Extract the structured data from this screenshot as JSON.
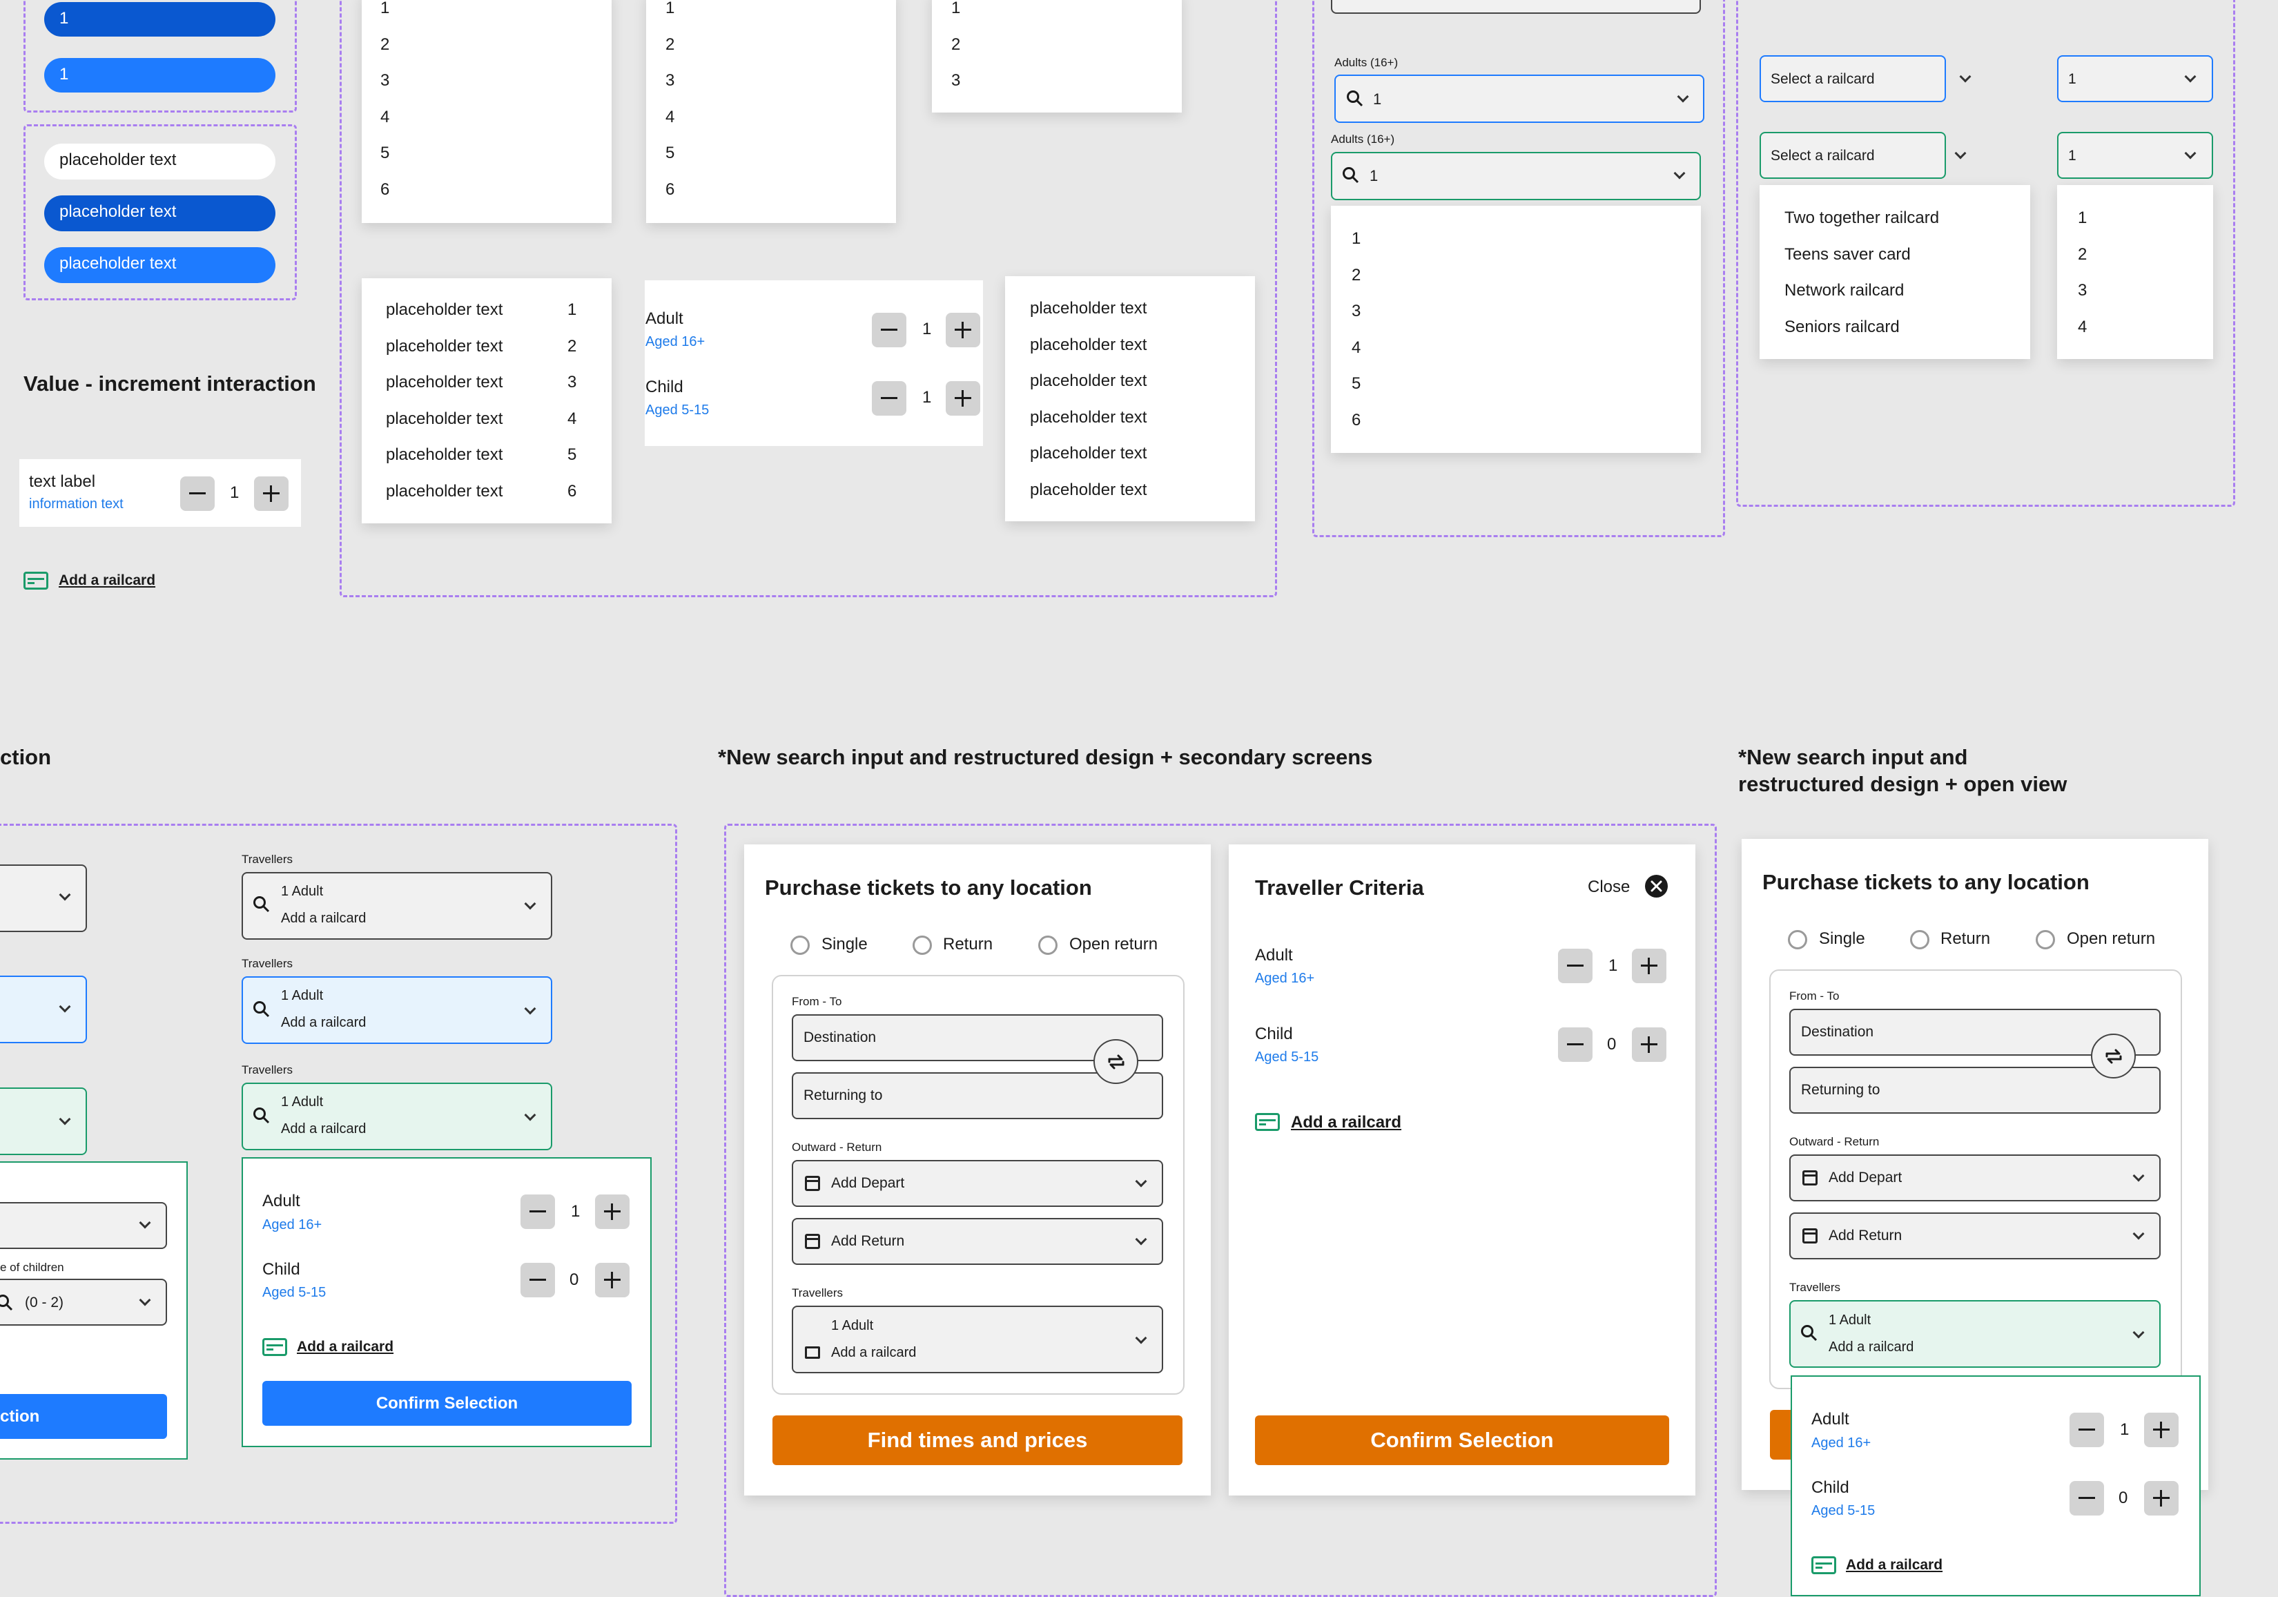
{
  "top_left_pills": {
    "pill1": "1",
    "pill2": "1"
  },
  "placeholder_pills": [
    "placeholder text",
    "placeholder text",
    "placeholder text"
  ],
  "increment": {
    "heading": "Value - increment interaction",
    "label": "text label",
    "info": "information text",
    "value": "1",
    "railcard_link": "Add a railcard"
  },
  "lists": {
    "list_a": [
      "1",
      "2",
      "3",
      "4",
      "5",
      "6"
    ],
    "list_b": [
      "1",
      "2",
      "3",
      "4",
      "5",
      "6"
    ],
    "list_c": [
      "1",
      "2",
      "3"
    ],
    "list_d_text": [
      "placeholder text",
      "placeholder text",
      "placeholder text",
      "placeholder text",
      "placeholder text",
      "placeholder text"
    ],
    "list_d_num": [
      "1",
      "2",
      "3",
      "4",
      "5",
      "6"
    ],
    "list_f": [
      "placeholder text",
      "placeholder text",
      "placeholder text",
      "placeholder text",
      "placeholder text",
      "placeholder text"
    ]
  },
  "travellers_mini": {
    "adult": "Adult",
    "adult_age": "Aged 16+",
    "adult_val": "1",
    "child": "Child",
    "child_age": "Aged 5-15",
    "child_val": "1"
  },
  "adults_select": {
    "label1": "Adults (16+)",
    "value1": "1",
    "label2": "Adults (16+)",
    "value2": "1",
    "options": [
      "1",
      "2",
      "3",
      "4",
      "5",
      "6"
    ]
  },
  "railcard_select": {
    "placeholder1": "Select a railcard",
    "placeholder2": "Select a railcard",
    "num1": "1",
    "num2": "1",
    "options": [
      "Two together railcard",
      "Teens saver card",
      "Network railcard",
      "Seniors railcard"
    ],
    "num_options": [
      "1",
      "2",
      "3",
      "4"
    ]
  },
  "section_left": {
    "heading_frag": "ction",
    "age_label": "e of children",
    "age_value": "(0 - 2)",
    "button_frag": "lection"
  },
  "travellers_fields": {
    "label": "Travellers",
    "line1": "1 Adult",
    "line2": "Add a railcard"
  },
  "traveller_panel": {
    "adult": "Adult",
    "adult_age": "Aged 16+",
    "adult_val": "1",
    "child": "Child",
    "child_age": "Aged 5-15",
    "child_val": "0",
    "railcard": "Add a railcard",
    "confirm": "Confirm Selection"
  },
  "section_mid": {
    "heading": "*New search input and restructured design + secondary screens"
  },
  "purchase": {
    "title": "Purchase tickets to any location",
    "radios": [
      "Single",
      "Return",
      "Open return"
    ],
    "from_to": "From - To",
    "destination": "Destination",
    "returning": "Returning to",
    "outward_return": "Outward - Return",
    "depart": "Add Depart",
    "return": "Add Return",
    "travellers": "Travellers",
    "trav_line1": "1 Adult",
    "trav_line2": "Add a railcard",
    "button": "Find times and prices"
  },
  "criteria": {
    "title": "Traveller Criteria",
    "close": "Close",
    "adult": "Adult",
    "adult_age": "Aged 16+",
    "adult_val": "1",
    "child": "Child",
    "child_age": "Aged 5-15",
    "child_val": "0",
    "railcard": "Add a railcard",
    "button": "Confirm Selection"
  },
  "section_right": {
    "heading_line1": "*New search input and",
    "heading_line2": "restructured design + open view"
  },
  "purchase2": {
    "title": "Purchase tickets to any location",
    "radios": [
      "Single",
      "Return",
      "Open return"
    ],
    "from_to": "From - To",
    "destination": "Destination",
    "returning": "Returning to",
    "outward_return": "Outward - Return",
    "depart": "Add Depart",
    "return": "Add Return",
    "travellers": "Travellers",
    "trav_line1": "1 Adult",
    "trav_line2": "Add a railcard",
    "adult": "Adult",
    "adult_age": "Aged 16+",
    "adult_val": "1",
    "child": "Child",
    "child_age": "Aged 5-15",
    "child_val": "0",
    "railcard": "Add a railcard"
  },
  "colors": {
    "accent_blue": "#1e7bff",
    "dark_blue": "#0a58d0",
    "orange": "#e07000",
    "green": "#1a9b6a",
    "dash": "#a97ef0"
  }
}
